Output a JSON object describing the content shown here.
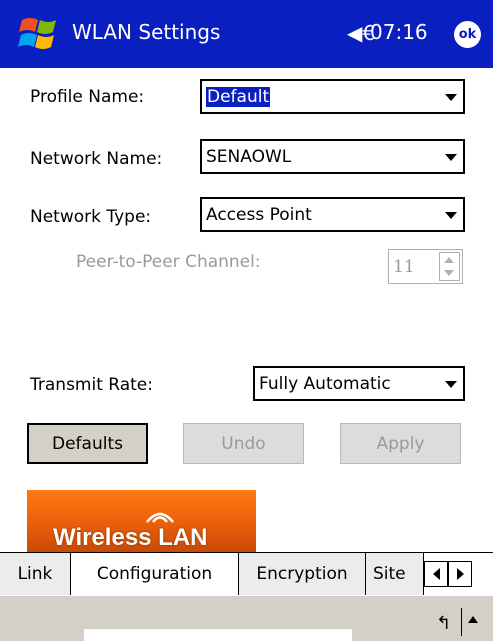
{
  "titlebar": {
    "app_title": "WLAN Settings",
    "volume_icon": "speaker-icon",
    "clock": "07:16",
    "ok_label": "ok",
    "start_icon": "windows-flag-icon",
    "bg_color": "#0a1fbf"
  },
  "form": {
    "profile_label": "Profile Name:",
    "profile_value": "Default",
    "network_name_label": "Network Name:",
    "network_name_value": "SENAOWL",
    "network_type_label": "Network Type:",
    "network_type_value": "Access Point",
    "channel_label": "Peer-to-Peer Channel:",
    "channel_value": "11",
    "transmit_label": "Transmit Rate:",
    "transmit_value": "Fully Automatic"
  },
  "buttons": {
    "defaults": "Defaults",
    "undo": "Undo",
    "apply": "Apply"
  },
  "banner": {
    "text": "Wireless LAN"
  },
  "tabs": [
    {
      "label": "Link",
      "active": false
    },
    {
      "label": "Configuration",
      "active": true
    },
    {
      "label": "Encryption",
      "active": false
    },
    {
      "label": "Site",
      "active": false
    }
  ],
  "cmdbar": {
    "sip_icon": "keyboard-return-icon",
    "sip_symbol": "↰"
  }
}
